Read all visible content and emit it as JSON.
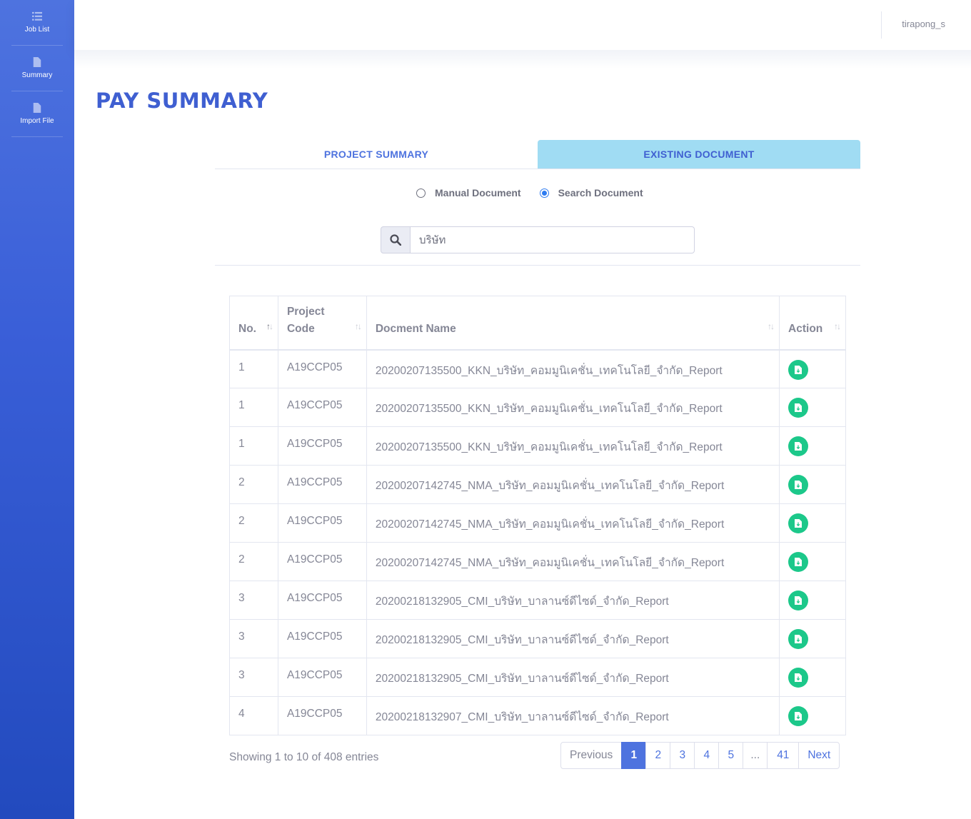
{
  "sidebar": {
    "items": [
      {
        "label": "Job List",
        "icon": "list-icon"
      },
      {
        "label": "Summary",
        "icon": "file-icon"
      },
      {
        "label": "Import File",
        "icon": "file-icon"
      }
    ]
  },
  "topbar": {
    "username": "tirapong_s"
  },
  "page": {
    "title": "PAY SUMMARY"
  },
  "tabs": [
    {
      "label": "PROJECT SUMMARY",
      "active": false
    },
    {
      "label": "EXISTING DOCUMENT",
      "active": true
    }
  ],
  "radios": [
    {
      "label": "Manual Document",
      "checked": false
    },
    {
      "label": "Search Document",
      "checked": true
    }
  ],
  "search": {
    "value": "บริษัท"
  },
  "table": {
    "headers": {
      "no": "No.",
      "project_code_1": "Project",
      "project_code_2": "Code",
      "name": "Docment Name",
      "action": "Action"
    },
    "rows": [
      {
        "no": "1",
        "code": "A19CCP05",
        "name": "20200207135500_KKN_บริษัท_คอมมูนิเคชั่น_เทคโนโลยี_จำกัด_Report"
      },
      {
        "no": "1",
        "code": "A19CCP05",
        "name": "20200207135500_KKN_บริษัท_คอมมูนิเคชั่น_เทคโนโลยี_จำกัด_Report"
      },
      {
        "no": "1",
        "code": "A19CCP05",
        "name": "20200207135500_KKN_บริษัท_คอมมูนิเคชั่น_เทคโนโลยี_จำกัด_Report"
      },
      {
        "no": "2",
        "code": "A19CCP05",
        "name": "20200207142745_NMA_บริษัท_คอมมูนิเคชั่น_เทคโนโลยี_จำกัด_Report"
      },
      {
        "no": "2",
        "code": "A19CCP05",
        "name": "20200207142745_NMA_บริษัท_คอมมูนิเคชั่น_เทคโนโลยี_จำกัด_Report"
      },
      {
        "no": "2",
        "code": "A19CCP05",
        "name": "20200207142745_NMA_บริษัท_คอมมูนิเคชั่น_เทคโนโลยี_จำกัด_Report"
      },
      {
        "no": "3",
        "code": "A19CCP05",
        "name": "20200218132905_CMI_บริษัท_บาลานซ์ดีไซด์_จำกัด_Report"
      },
      {
        "no": "3",
        "code": "A19CCP05",
        "name": "20200218132905_CMI_บริษัท_บาลานซ์ดีไซด์_จำกัด_Report"
      },
      {
        "no": "3",
        "code": "A19CCP05",
        "name": "20200218132905_CMI_บริษัท_บาลานซ์ดีไซด์_จำกัด_Report"
      },
      {
        "no": "4",
        "code": "A19CCP05",
        "name": "20200218132907_CMI_บริษัท_บาลานซ์ดีไซด์_จำกัด_Report"
      }
    ]
  },
  "footer": {
    "info": "Showing 1 to 10 of 408 entries"
  },
  "pagination": {
    "items": [
      "Previous",
      "1",
      "2",
      "3",
      "4",
      "5",
      "...",
      "41",
      "Next"
    ],
    "active": "1"
  },
  "colors": {
    "primary": "#4e73df",
    "success": "#1cc88a",
    "tab_active": "#a0dcf3"
  }
}
